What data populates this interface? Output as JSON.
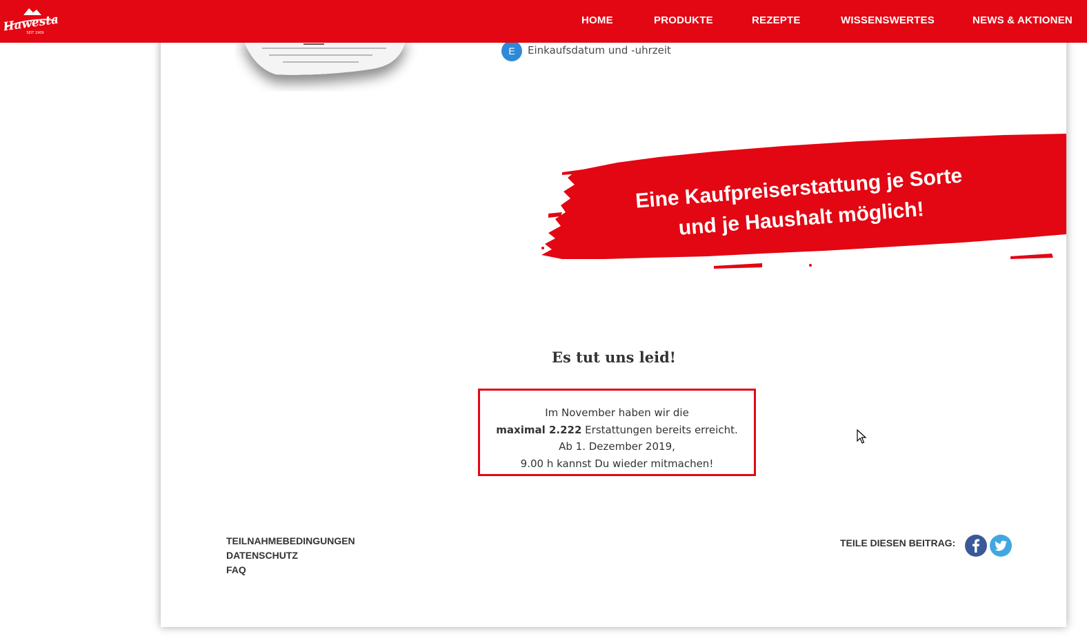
{
  "brand": {
    "name": "Hawesta",
    "tagline": "SEIT 1909",
    "color": "#e30613"
  },
  "nav": {
    "items": [
      "HOME",
      "PRODUKTE",
      "REZEPTE",
      "WISSENSWERTES",
      "NEWS & AKTIONEN"
    ]
  },
  "receipt_list": {
    "badge": "E",
    "text": "Einkaufsdatum und -uhrzeit",
    "badge_color": "#2e8ad8"
  },
  "banner": {
    "line1": "Eine Kaufpreiserstattung je Sorte",
    "line2": "und je Haushalt möglich!"
  },
  "notice": {
    "heading": "Es tut uns leid!",
    "line1": "Im November haben wir die",
    "line2_bold": "maximal 2.222",
    "line2_rest": " Erstattungen bereits erreicht.",
    "line3": "Ab 1. Dezember 2019,",
    "line4": "9.00 h kannst Du wieder mitmachen!"
  },
  "footer": {
    "links": [
      "TEILNAHMEBEDINGUNGEN",
      "DATENSCHUTZ",
      "FAQ"
    ],
    "share_label": "TEILE DIESEN BEITRAG:",
    "social": [
      "facebook-icon",
      "twitter-icon"
    ]
  }
}
